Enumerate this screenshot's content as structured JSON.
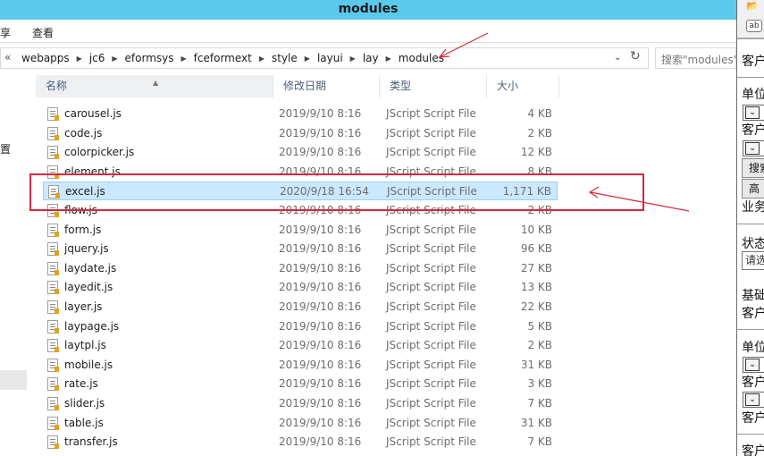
{
  "window": {
    "title": "modules"
  },
  "ribbon": {
    "share": "享",
    "view": "查看"
  },
  "address": {
    "back": "«",
    "breadcrumbs": [
      "webapps",
      "jc6",
      "eformsys",
      "fceformext",
      "style",
      "layui",
      "lay",
      "modules"
    ]
  },
  "search": {
    "placeholder": "搜索\"modules\""
  },
  "nav": {
    "partial_char": "置"
  },
  "columns": {
    "name": "名称",
    "date": "修改日期",
    "type": "类型",
    "size": "大小"
  },
  "files": [
    {
      "name": "carousel.js",
      "date": "2019/9/10 8:16",
      "type": "JScript Script File",
      "size": "4 KB"
    },
    {
      "name": "code.js",
      "date": "2019/9/10 8:16",
      "type": "JScript Script File",
      "size": "2 KB"
    },
    {
      "name": "colorpicker.js",
      "date": "2019/9/10 8:16",
      "type": "JScript Script File",
      "size": "12 KB"
    },
    {
      "name": "element.js",
      "date": "2019/9/10 8:16",
      "type": "JScript Script File",
      "size": "8 KB"
    },
    {
      "name": "excel.js",
      "date": "2020/9/18 16:54",
      "type": "JScript Script File",
      "size": "1,171 KB"
    },
    {
      "name": "flow.js",
      "date": "2019/9/10 8:16",
      "type": "JScript Script File",
      "size": "2 KB"
    },
    {
      "name": "form.js",
      "date": "2019/9/10 8:16",
      "type": "JScript Script File",
      "size": "10 KB"
    },
    {
      "name": "jquery.js",
      "date": "2019/9/10 8:16",
      "type": "JScript Script File",
      "size": "96 KB"
    },
    {
      "name": "laydate.js",
      "date": "2019/9/10 8:16",
      "type": "JScript Script File",
      "size": "27 KB"
    },
    {
      "name": "layedit.js",
      "date": "2019/9/10 8:16",
      "type": "JScript Script File",
      "size": "13 KB"
    },
    {
      "name": "layer.js",
      "date": "2019/9/10 8:16",
      "type": "JScript Script File",
      "size": "22 KB"
    },
    {
      "name": "laypage.js",
      "date": "2019/9/10 8:16",
      "type": "JScript Script File",
      "size": "5 KB"
    },
    {
      "name": "laytpl.js",
      "date": "2019/9/10 8:16",
      "type": "JScript Script File",
      "size": "2 KB"
    },
    {
      "name": "mobile.js",
      "date": "2019/9/10 8:16",
      "type": "JScript Script File",
      "size": "31 KB"
    },
    {
      "name": "rate.js",
      "date": "2019/9/10 8:16",
      "type": "JScript Script File",
      "size": "3 KB"
    },
    {
      "name": "slider.js",
      "date": "2019/9/10 8:16",
      "type": "JScript Script File",
      "size": "7 KB"
    },
    {
      "name": "table.js",
      "date": "2019/9/10 8:16",
      "type": "JScript Script File",
      "size": "31 KB"
    },
    {
      "name": "transfer.js",
      "date": "2019/9/10 8:16",
      "type": "JScript Script File",
      "size": "7 KB"
    }
  ],
  "selected_file": "excel.js",
  "annotation_color": "#d7283b",
  "selection_color": "#cce8ff",
  "right_panel": {
    "ab_label": "ab",
    "labels": [
      "客户",
      "单位",
      "客户",
      "搜索",
      "高",
      "业务",
      "状态",
      "请选",
      "基础",
      "客户",
      "单位",
      "客户",
      "客户",
      "客户"
    ]
  }
}
